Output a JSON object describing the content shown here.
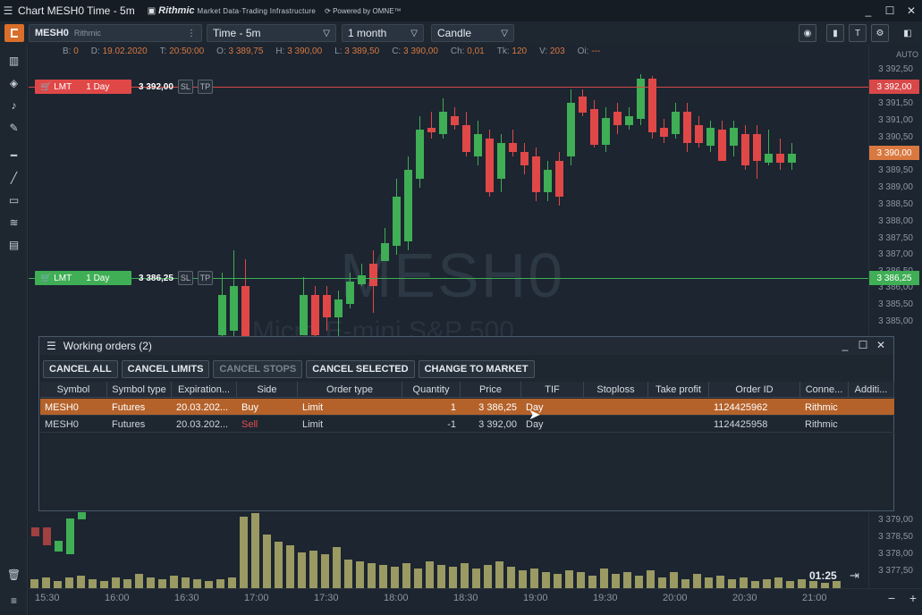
{
  "window": {
    "title": "Chart MESH0 Time - 5m",
    "brand": "Rithmic",
    "brand_sub": "Market Data·Trading Infrastructure",
    "powered": "Powered by OMNE™"
  },
  "toolbar": {
    "symbol": "MESH0",
    "connection": "Rithmic",
    "timeframe": "Time - 5m",
    "period": "1 month",
    "chart_type": "Candle"
  },
  "infobar": {
    "B": "0",
    "D": "19.02.2020",
    "T": "20:50:00",
    "O": "3 389,75",
    "H": "3 390,00",
    "L": "3 389,50",
    "C": "3 390,00",
    "Ch": "0,01",
    "Tk": "120",
    "V": "203",
    "Oi": "---"
  },
  "watermark": {
    "symbol": "MESH0",
    "name": "Micro E-mini S&P 500"
  },
  "orders_on_chart": [
    {
      "type": "LMT",
      "tif": "1 Day",
      "price": "3 392,00",
      "side": "sell",
      "color": "#e04848"
    },
    {
      "type": "LMT",
      "tif": "1 Day",
      "price": "3 386,25",
      "side": "buy",
      "color": "#3fae55"
    }
  ],
  "price_axis": {
    "auto": "AUTO",
    "labels": [
      "3 392,50",
      "3 392,00",
      "3 391,50",
      "3 391,00",
      "3 390,50",
      "3 390,00",
      "3 389,50",
      "3 389,00",
      "3 388,50",
      "3 388,00",
      "3 387,50",
      "3 387,00",
      "3 386,50",
      "3 386,25",
      "3 386,00",
      "3 385,50",
      "3 385,00",
      "3 379,00",
      "3 378,50",
      "3 378,00",
      "3 377,50"
    ],
    "last_price": "3 390,00"
  },
  "time_axis": [
    "15:30",
    "16:00",
    "16:30",
    "17:00",
    "17:30",
    "18:00",
    "18:30",
    "19:00",
    "19:30",
    "20:00",
    "20:30",
    "21:00"
  ],
  "countdown": "01:25",
  "chart_data": {
    "type": "candlestick",
    "x": [
      "15:30",
      "16:00",
      "16:30",
      "17:00",
      "17:30",
      "18:00",
      "18:30",
      "19:00",
      "19:30",
      "20:00",
      "20:30"
    ],
    "y_range": [
      3377.5,
      3392.5
    ]
  },
  "working_orders": {
    "title": "Working orders (2)",
    "buttons": [
      "CANCEL ALL",
      "CANCEL LIMITS",
      "CANCEL STOPS",
      "CANCEL SELECTED",
      "CHANGE TO MARKET"
    ],
    "columns": [
      "Symbol",
      "Symbol type",
      "Expiration...",
      "Side",
      "Order type",
      "Quantity",
      "Price",
      "TIF",
      "Stoploss",
      "Take profit",
      "Order ID",
      "Conne...",
      "Additi..."
    ],
    "rows": [
      {
        "symbol": "MESH0",
        "symbol_type": "Futures",
        "expiration": "20.03.202...",
        "side": "Buy",
        "order_type": "Limit",
        "quantity": "1",
        "price": "3 386,25",
        "tif": "Day",
        "stoploss": "",
        "take_profit": "",
        "order_id": "1124425962",
        "connection": "Rithmic",
        "additional": ""
      },
      {
        "symbol": "MESH0",
        "symbol_type": "Futures",
        "expiration": "20.03.202...",
        "side": "Sell",
        "order_type": "Limit",
        "quantity": "-1",
        "price": "3 392,00",
        "tif": "Day",
        "stoploss": "",
        "take_profit": "",
        "order_id": "1124425958",
        "connection": "Rithmic",
        "additional": ""
      }
    ]
  }
}
